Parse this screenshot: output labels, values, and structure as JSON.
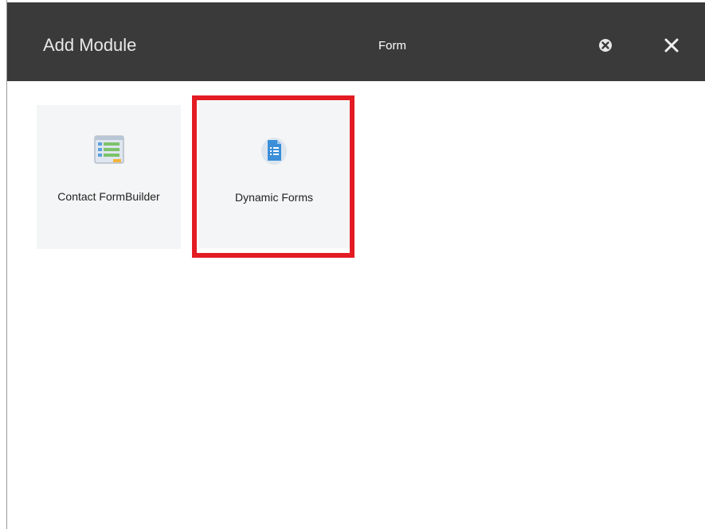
{
  "dialog": {
    "title": "Add Module",
    "search_value": "Form",
    "clear_icon": "circle-x-icon",
    "close_icon": "close-icon"
  },
  "modules": [
    {
      "label": "Contact FormBuilder",
      "icon": "form-builder-icon"
    },
    {
      "label": "Dynamic Forms",
      "icon": "document-list-icon"
    }
  ],
  "highlight": {
    "target": "Dynamic Forms",
    "color": "#e31b23"
  },
  "colors": {
    "header_bg": "#3a3a3a",
    "card_bg": "#f4f5f6",
    "accent_blue": "#3c8ed8"
  }
}
